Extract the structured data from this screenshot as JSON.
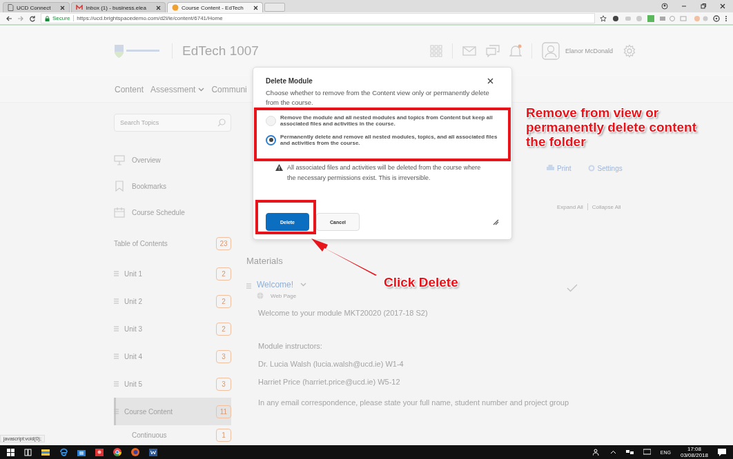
{
  "browser": {
    "tabs": [
      {
        "title": "UCD Connect",
        "kind": "page",
        "selected": false
      },
      {
        "title": "Inbox (1) - business.elea",
        "kind": "mail",
        "selected": false
      },
      {
        "title": "Course Content - EdTech",
        "kind": "course",
        "selected": true
      }
    ],
    "secure_label": "Secure",
    "url": "https://ucd.brightspacedemo.com/d2l/le/content/6741/Home"
  },
  "header": {
    "course_title": "EdTech 1007",
    "user_name": "Elanor McDonald"
  },
  "nav": [
    {
      "label": "Content",
      "dropdown": false
    },
    {
      "label": "Assessment",
      "dropdown": true
    },
    {
      "label": "Communi",
      "dropdown": false
    }
  ],
  "sidebar": {
    "search_placeholder": "Search Topics",
    "links": [
      {
        "label": "Overview",
        "kind": "overview"
      },
      {
        "label": "Bookmarks",
        "kind": "bookmark"
      },
      {
        "label": "Course Schedule",
        "kind": "calendar"
      }
    ],
    "toc": {
      "label": "Table of Contents",
      "count": "23"
    },
    "units": [
      {
        "label": "Unit 1",
        "count": "2",
        "selected": false
      },
      {
        "label": "Unit 2",
        "count": "2",
        "selected": false
      },
      {
        "label": "Unit 3",
        "count": "2",
        "selected": false
      },
      {
        "label": "Unit 4",
        "count": "3",
        "selected": false
      },
      {
        "label": "Unit 5",
        "count": "3",
        "selected": false
      },
      {
        "label": "Course Content",
        "count": "11",
        "selected": true,
        "children": [
          {
            "label": "Continuous",
            "count": "1"
          }
        ]
      }
    ]
  },
  "main": {
    "toolbar": [
      {
        "label": "Print",
        "kind": "print"
      },
      {
        "label": "Settings",
        "kind": "settings"
      }
    ],
    "expand": "Expand All",
    "collapse": "Collapse All",
    "section": "Materials",
    "topic": {
      "title": "Welcome!",
      "type": "Web Page",
      "completed": true
    },
    "paragraphs": [
      "Welcome to your module MKT20020 (2017-18 S2)",
      "Module instructors:",
      "Dr. Lucia Walsh (lucia.walsh@ucd.ie) W1-4",
      "Harriet Price (harriet.price@ucd.ie) W5-12",
      "In any email correspondence, please state your full name, student number and project group"
    ]
  },
  "status_text": "javascript:void(0);",
  "dialog": {
    "title": "Delete Module",
    "description": "Choose whether to remove from the Content view only or permanently delete from the course.",
    "options": [
      {
        "label": "Remove the module and all nested modules and topics from Content but keep all associated files and activities in the course.",
        "selected": false
      },
      {
        "label": "Permanently delete and remove all nested modules, topics, and all associated files and activities from the course.",
        "selected": true
      }
    ],
    "warning": "All associated files and activities will be deleted from the course where the necessary permissions exist. This is irreversible.",
    "buttons": [
      {
        "label": "Delete",
        "kind": "primary"
      },
      {
        "label": "Cancel",
        "kind": "secondary"
      }
    ]
  },
  "callouts": [
    "Remove from view or permanently delete content the folder",
    "Click Delete"
  ],
  "taskbar": {
    "language": "ENG",
    "time": "17:08",
    "date": "03/08/2018"
  }
}
